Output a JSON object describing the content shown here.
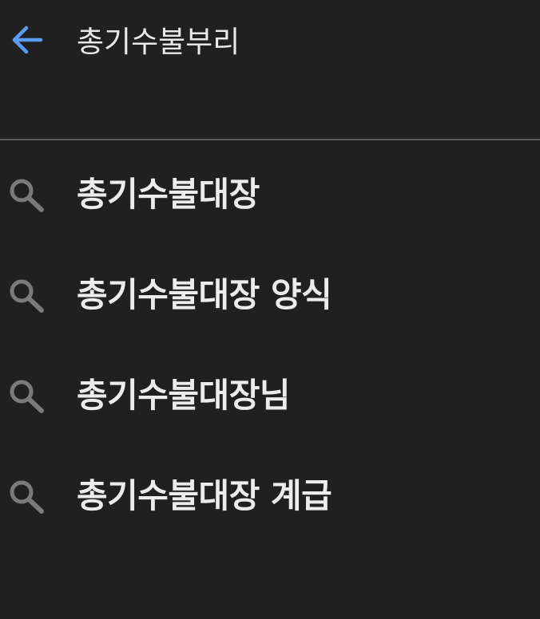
{
  "search": {
    "query": "총기수불부리",
    "back_icon": "arrow-left-icon",
    "back_color": "#5b9bf0"
  },
  "suggestions": [
    {
      "text": "총기수불대장",
      "icon": "search-icon"
    },
    {
      "text": "총기수불대장 양식",
      "icon": "search-icon"
    },
    {
      "text": "총기수불대장님",
      "icon": "search-icon"
    },
    {
      "text": "총기수불대장 계급",
      "icon": "search-icon"
    }
  ],
  "colors": {
    "background": "#202020",
    "text": "#ececec",
    "icon": "#7a7a7a",
    "divider": "#5a5a5a"
  }
}
